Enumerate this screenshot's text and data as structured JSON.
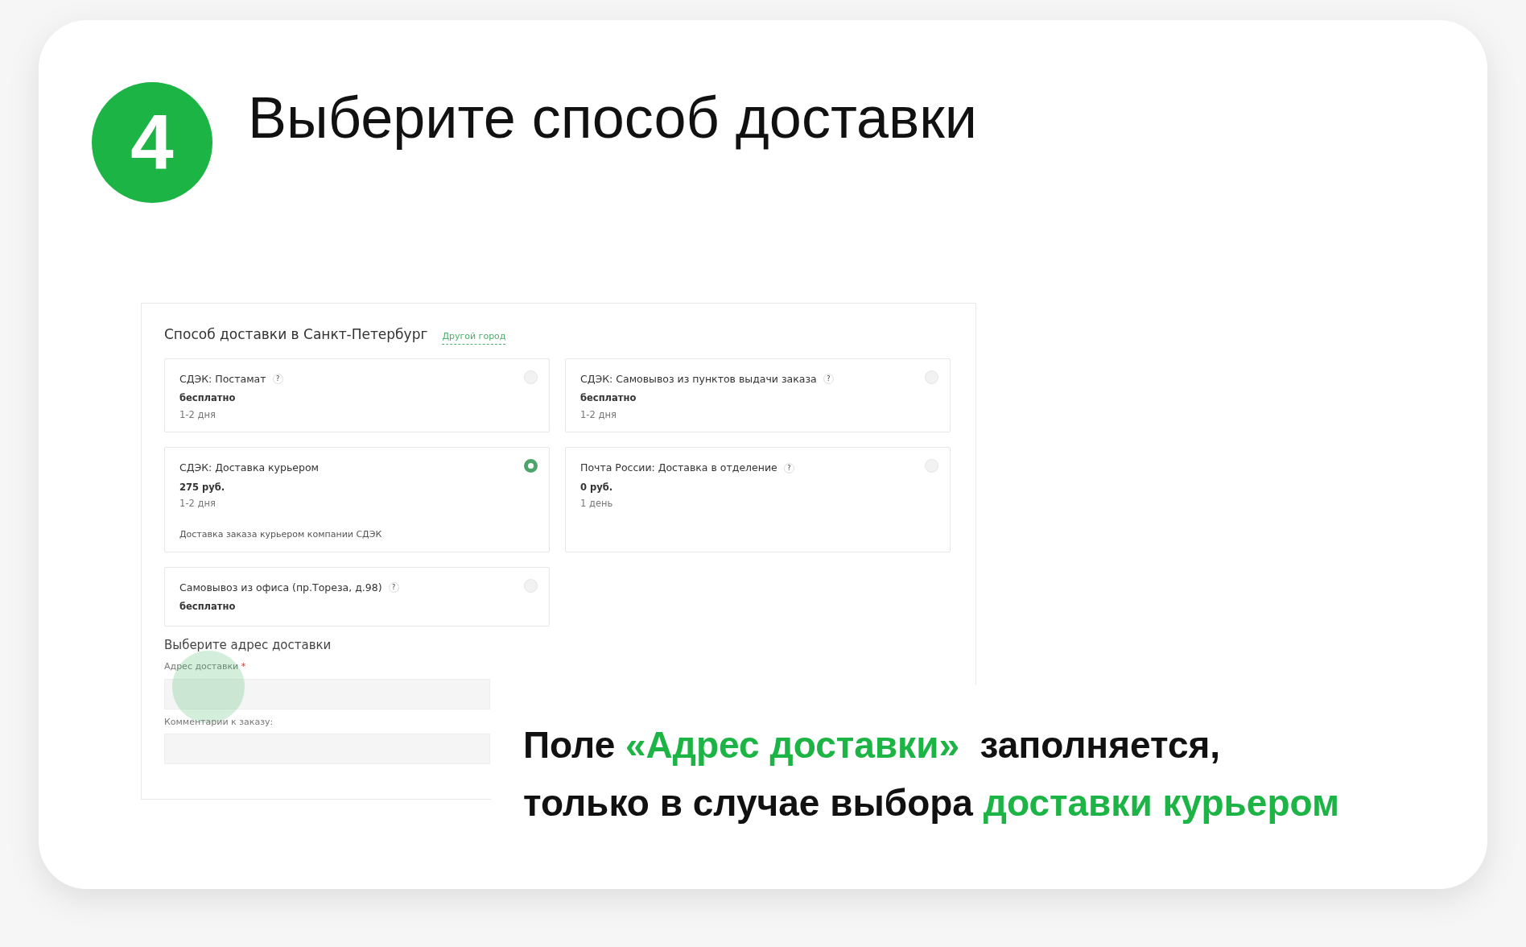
{
  "step": {
    "number": "4",
    "title": "Выберите способ доставки"
  },
  "screenshot": {
    "heading": "Способ доставки в Санкт-Петербург",
    "city_link": "Другой город",
    "options": [
      {
        "name": "СДЭК: Постамат",
        "help": "?",
        "price": "бесплатно",
        "term": "1-2 дня",
        "selected": false
      },
      {
        "name": "СДЭК: Самовывоз из пунктов выдачи заказа",
        "help": "?",
        "price": "бесплатно",
        "term": "1-2 дня",
        "selected": false
      },
      {
        "name": "СДЭК: Доставка курьером",
        "price": "275 руб.",
        "term": "1-2 дня",
        "description": "Доставка заказа курьером компании СДЭК",
        "selected": true
      },
      {
        "name": "Почта России: Доставка в отделение",
        "help": "?",
        "price": "0 руб.",
        "term": "1 день",
        "selected": false
      },
      {
        "name": "Самовывоз из офиса (пр.Тореза, д.98)",
        "help": "?",
        "price": "бесплатно",
        "selected": false
      }
    ],
    "address_heading": "Выберите адрес доставки",
    "fields": [
      {
        "label": "Адрес доставки",
        "required_mark": "*",
        "highlighted": true
      },
      {
        "label": "Комментарии к заказу:",
        "highlighted": false
      }
    ]
  },
  "caption": {
    "lines": [
      [
        {
          "text": "Поле ",
          "accent": false
        },
        {
          "text": "«Адрес доставки»",
          "accent": true
        },
        {
          "text": "  заполняется,",
          "accent": false
        }
      ],
      [
        {
          "text": "только в случае выбора ",
          "accent": false
        },
        {
          "text": "доставки курьером",
          "accent": true
        }
      ]
    ]
  }
}
